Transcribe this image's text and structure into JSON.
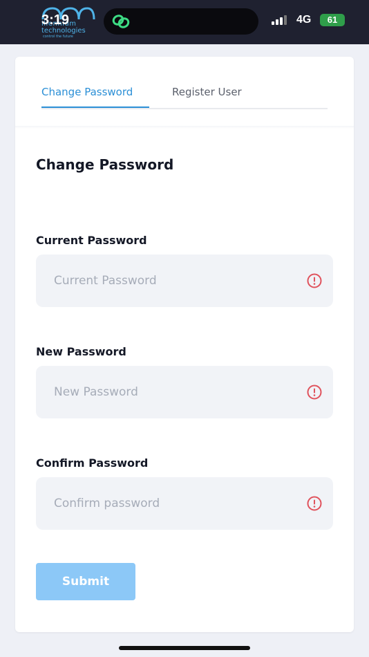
{
  "status_bar": {
    "time": "3:19",
    "network": "4G",
    "battery": "61",
    "logo": {
      "line1": "illennium",
      "line2": "technologies",
      "line3": "control the future"
    }
  },
  "tabs": [
    {
      "label": "Change Password",
      "active": true
    },
    {
      "label": "Register User",
      "active": false
    }
  ],
  "form": {
    "title": "Change Password",
    "fields": [
      {
        "label": "Current Password",
        "placeholder": "Current Password",
        "value": ""
      },
      {
        "label": "New Password",
        "placeholder": "New Password",
        "value": ""
      },
      {
        "label": "Confirm Password",
        "placeholder": "Confirm password",
        "value": ""
      }
    ],
    "submit_label": "Submit"
  },
  "colors": {
    "accent": "#2b8fd6",
    "error": "#e0525c",
    "submit_bg": "#8cc8f7",
    "status_bar_bg": "#1f2130"
  },
  "icons": [
    "link-icon",
    "signal-icon",
    "battery-icon",
    "error-circle-icon"
  ]
}
